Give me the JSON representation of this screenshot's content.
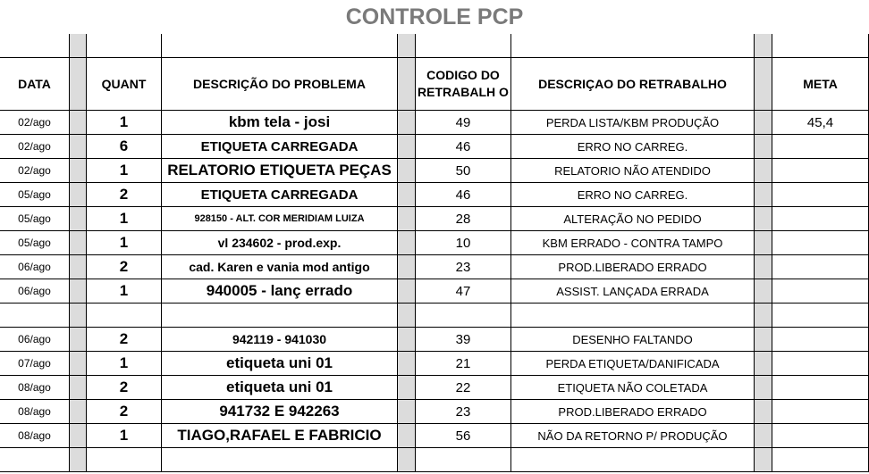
{
  "title": "CONTROLE PCP",
  "headers": {
    "data": "DATA",
    "quant": "QUANT",
    "descricao_problema": "DESCRIÇÃO DO PROBLEMA",
    "codigo_retrabalho": "CODIGO DO RETRABALH O",
    "descricao_retrabalho": "DESCRIÇAO DO RETRABALHO",
    "meta": "META"
  },
  "rows": [
    {
      "date": "02/ago",
      "quant": "1",
      "desc": "kbm tela - josi",
      "code": "49",
      "rdesc": "PERDA LISTA/KBM PRODUÇÃO",
      "meta": "45,4"
    },
    {
      "date": "02/ago",
      "quant": "6",
      "desc": "ETIQUETA CARREGADA",
      "code": "46",
      "rdesc": "ERRO NO CARREG.",
      "meta": ""
    },
    {
      "date": "02/ago",
      "quant": "1",
      "desc": "RELATORIO ETIQUETA PEÇAS",
      "code": "50",
      "rdesc": "RELATORIO NÃO ATENDIDO",
      "meta": ""
    },
    {
      "date": "05/ago",
      "quant": "2",
      "desc": "ETIQUETA CARREGADA",
      "code": "46",
      "rdesc": "ERRO NO CARREG.",
      "meta": ""
    },
    {
      "date": "05/ago",
      "quant": "1",
      "desc": "928150 - ALT. COR MERIDIAM LUIZA",
      "code": "28",
      "rdesc": "ALTERAÇÃO NO PEDIDO",
      "meta": ""
    },
    {
      "date": "05/ago",
      "quant": "1",
      "desc": "vl 234602 - prod.exp.",
      "code": "10",
      "rdesc": "KBM ERRADO - CONTRA TAMPO",
      "meta": ""
    },
    {
      "date": "06/ago",
      "quant": "2",
      "desc": "cad. Karen e vania mod antigo",
      "code": "23",
      "rdesc": "PROD.LIBERADO ERRADO",
      "meta": ""
    },
    {
      "date": "06/ago",
      "quant": "1",
      "desc": "940005 - lanç errado",
      "code": "47",
      "rdesc": "ASSIST. LANÇADA ERRADA",
      "meta": ""
    },
    {
      "date": "",
      "quant": "",
      "desc": "",
      "code": "",
      "rdesc": "",
      "meta": ""
    },
    {
      "date": "06/ago",
      "quant": "2",
      "desc": "942119 - 941030",
      "code": "39",
      "rdesc": "DESENHO  FALTANDO",
      "meta": ""
    },
    {
      "date": "07/ago",
      "quant": "1",
      "desc": "etiqueta uni 01",
      "code": "21",
      "rdesc": "PERDA ETIQUETA/DANIFICADA",
      "meta": ""
    },
    {
      "date": "08/ago",
      "quant": "2",
      "desc": "etiqueta uni 01",
      "code": "22",
      "rdesc": "ETIQUETA NÃO COLETADA",
      "meta": ""
    },
    {
      "date": "08/ago",
      "quant": "2",
      "desc": "941732 E 942263",
      "code": "23",
      "rdesc": "PROD.LIBERADO ERRADO",
      "meta": ""
    },
    {
      "date": "08/ago",
      "quant": "1",
      "desc": "TIAGO,RAFAEL E FABRICIO",
      "code": "56",
      "rdesc": "NÃO DA RETORNO P/ PRODUÇÃO",
      "meta": ""
    },
    {
      "date": "",
      "quant": "",
      "desc": "",
      "code": "",
      "rdesc": "",
      "meta": ""
    }
  ]
}
